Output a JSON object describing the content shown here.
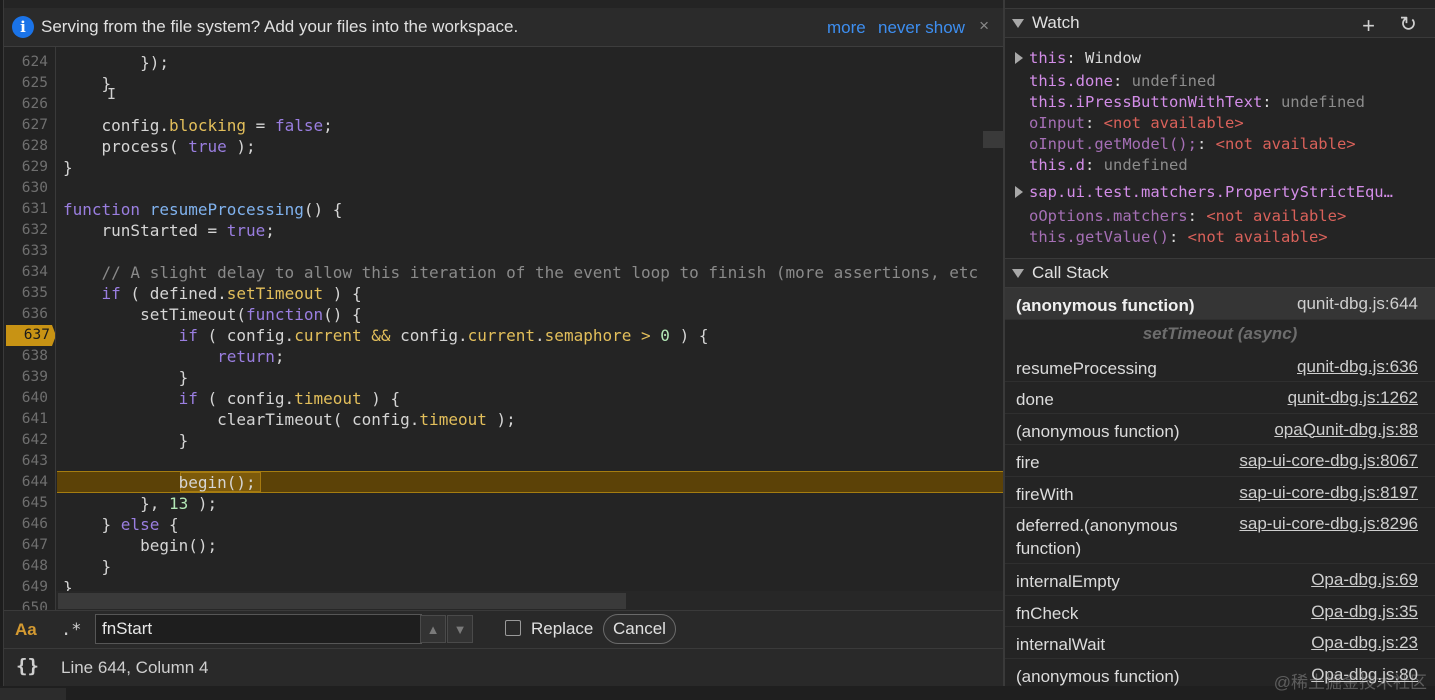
{
  "infobar": {
    "message": "Serving from the file system? Add your files into the workspace.",
    "more": "more",
    "never_show": "never show",
    "close": "×"
  },
  "editor": {
    "lines": [
      {
        "n": "624",
        "segs": [
          [
            "p",
            "        });"
          ]
        ]
      },
      {
        "n": "625",
        "segs": [
          [
            "p",
            "    }"
          ]
        ]
      },
      {
        "n": "626",
        "segs": []
      },
      {
        "n": "627",
        "segs": [
          [
            "p",
            "    config."
          ],
          [
            "pr",
            "blocking"
          ],
          [
            "p",
            " = "
          ],
          [
            "kw",
            "false"
          ],
          [
            "p",
            ";"
          ]
        ]
      },
      {
        "n": "628",
        "segs": [
          [
            "p",
            "    process( "
          ],
          [
            "kw",
            "true"
          ],
          [
            "p",
            " );"
          ]
        ]
      },
      {
        "n": "629",
        "segs": [
          [
            "p",
            "}"
          ]
        ]
      },
      {
        "n": "630",
        "segs": []
      },
      {
        "n": "631",
        "segs": [
          [
            "kw",
            "function"
          ],
          [
            "p",
            " "
          ],
          [
            "fn",
            "resumeProcessing"
          ],
          [
            "p",
            "() {"
          ]
        ]
      },
      {
        "n": "632",
        "segs": [
          [
            "p",
            "    runStarted = "
          ],
          [
            "kw",
            "true"
          ],
          [
            "p",
            ";"
          ]
        ]
      },
      {
        "n": "633",
        "segs": []
      },
      {
        "n": "634",
        "segs": [
          [
            "cm",
            "    // A slight delay to allow this iteration of the event loop to finish (more assertions, etc"
          ]
        ]
      },
      {
        "n": "635",
        "segs": [
          [
            "p",
            "    "
          ],
          [
            "kw",
            "if"
          ],
          [
            "p",
            " ( defined."
          ],
          [
            "pr",
            "setTimeout"
          ],
          [
            "p",
            " ) {"
          ]
        ]
      },
      {
        "n": "636",
        "segs": [
          [
            "p",
            "        setTimeout("
          ],
          [
            "kw",
            "function"
          ],
          [
            "p",
            "() {"
          ]
        ]
      },
      {
        "n": "637",
        "segs": [
          [
            "p",
            "            "
          ],
          [
            "kw",
            "if"
          ],
          [
            "p",
            " ( config."
          ],
          [
            "pr",
            "current"
          ],
          [
            "p",
            " "
          ],
          [
            "pr",
            "&&"
          ],
          [
            "p",
            " config."
          ],
          [
            "pr",
            "current"
          ],
          [
            "p",
            "."
          ],
          [
            "pr",
            "semaphore"
          ],
          [
            "p",
            " "
          ],
          [
            "pr",
            ">"
          ],
          [
            "p",
            " "
          ],
          [
            "num",
            "0"
          ],
          [
            "p",
            " ) {"
          ]
        ]
      },
      {
        "n": "638",
        "segs": [
          [
            "p",
            "                "
          ],
          [
            "kw",
            "return"
          ],
          [
            "p",
            ";"
          ]
        ]
      },
      {
        "n": "639",
        "segs": [
          [
            "p",
            "            }"
          ]
        ]
      },
      {
        "n": "640",
        "segs": [
          [
            "p",
            "            "
          ],
          [
            "kw",
            "if"
          ],
          [
            "p",
            " ( config."
          ],
          [
            "pr",
            "timeout"
          ],
          [
            "p",
            " ) {"
          ]
        ]
      },
      {
        "n": "641",
        "segs": [
          [
            "p",
            "                clearTimeout( config."
          ],
          [
            "pr",
            "timeout"
          ],
          [
            "p",
            " );"
          ]
        ]
      },
      {
        "n": "642",
        "segs": [
          [
            "p",
            "            }"
          ]
        ]
      },
      {
        "n": "643",
        "segs": []
      },
      {
        "n": "644",
        "segs": [
          [
            "p",
            "            begin();"
          ]
        ]
      },
      {
        "n": "645",
        "segs": [
          [
            "p",
            "        }, "
          ],
          [
            "num",
            "13"
          ],
          [
            "p",
            " );"
          ]
        ]
      },
      {
        "n": "646",
        "segs": [
          [
            "p",
            "    } "
          ],
          [
            "kw",
            "else"
          ],
          [
            "p",
            " {"
          ]
        ]
      },
      {
        "n": "647",
        "segs": [
          [
            "p",
            "        begin();"
          ]
        ]
      },
      {
        "n": "648",
        "segs": [
          [
            "p",
            "    }"
          ]
        ]
      },
      {
        "n": "649",
        "segs": [
          [
            "p",
            "}"
          ]
        ]
      },
      {
        "n": "650",
        "segs": []
      }
    ],
    "breakpoint_line": "637",
    "exec_line": "644"
  },
  "search": {
    "case_toggle": "Aa",
    "regex_toggle": ".*",
    "value": "fnStart",
    "up": "▲",
    "down": "▼",
    "replace_label": "Replace",
    "cancel": "Cancel"
  },
  "status": {
    "pretty_print": "{}",
    "position": "Line 644, Column 4"
  },
  "watch": {
    "title": "Watch",
    "add": "+",
    "refresh": "↻",
    "items": [
      {
        "key": "this",
        "sep": ": ",
        "val": "Window",
        "vtype": "v",
        "expandable": true,
        "kstyle": "k"
      },
      {
        "key": "this.done",
        "sep": ": ",
        "val": "undefined",
        "vtype": "u",
        "expandable": false,
        "kstyle": "k"
      },
      {
        "key": "this.iPressButtonWithText",
        "sep": ": ",
        "val": "undefined",
        "vtype": "u",
        "expandable": false,
        "kstyle": "k"
      },
      {
        "key": "oInput",
        "sep": ": ",
        "val": "<not available>",
        "vtype": "na",
        "expandable": false,
        "kstyle": "ku"
      },
      {
        "key": "oInput.getModel();",
        "sep": ": ",
        "val": "<not available>",
        "vtype": "na",
        "expandable": false,
        "kstyle": "ku"
      },
      {
        "key": "this.d",
        "sep": ": ",
        "val": "undefined",
        "vtype": "u",
        "expandable": false,
        "kstyle": "k"
      },
      {
        "key": "sap.ui.test.matchers.PropertyStrictEqu…",
        "sep": "",
        "val": "",
        "vtype": "v",
        "expandable": true,
        "kstyle": "k"
      },
      {
        "key": "oOptions.matchers",
        "sep": ": ",
        "val": "<not available>",
        "vtype": "na",
        "expandable": false,
        "kstyle": "ku"
      },
      {
        "key": "this.getValue()",
        "sep": ": ",
        "val": "<not available>",
        "vtype": "na",
        "expandable": false,
        "kstyle": "ku"
      }
    ]
  },
  "callstack": {
    "title": "Call Stack",
    "async_label": "setTimeout (async)",
    "frames": [
      {
        "fn": "(anonymous function)",
        "loc": "qunit-dbg.js:644",
        "selected": true
      },
      {
        "fn": "resumeProcessing",
        "loc": "qunit-dbg.js:636"
      },
      {
        "fn": "done",
        "loc": "qunit-dbg.js:1262"
      },
      {
        "fn": "(anonymous function)",
        "loc": "opaQunit-dbg.js:88"
      },
      {
        "fn": "fire",
        "loc": "sap-ui-core-dbg.js:8067"
      },
      {
        "fn": "fireWith",
        "loc": "sap-ui-core-dbg.js:8197"
      },
      {
        "fn": "deferred.(anonymous function)",
        "loc": "sap-ui-core-dbg.js:8296"
      },
      {
        "fn": "internalEmpty",
        "loc": "Opa-dbg.js:69"
      },
      {
        "fn": "fnCheck",
        "loc": "Opa-dbg.js:35"
      },
      {
        "fn": "internalWait",
        "loc": "Opa-dbg.js:23"
      },
      {
        "fn": "(anonymous function)",
        "loc": "Opa-dbg.js:80"
      }
    ]
  },
  "watermark": "@稀土掘金技术社区"
}
